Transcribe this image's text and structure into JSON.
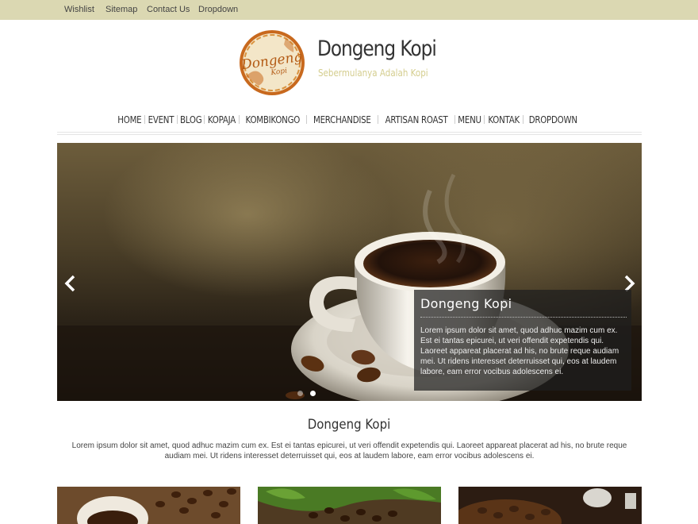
{
  "topbar": {
    "links": [
      "Wishlist",
      "Sitemap",
      "Contact Us",
      "Dropdown"
    ]
  },
  "header": {
    "logo_text_line1": "Dongeng",
    "logo_text_line2": "Kopi",
    "site_title": "Dongeng Kopi",
    "tagline": "Sebermulanya Adalah Kopi"
  },
  "nav": {
    "items": [
      "HOME",
      "EVENT",
      "BLOG",
      "KOPAJA",
      "KOMBIKONGO",
      "MERCHANDISE",
      "ARTISAN ROAST",
      "MENU",
      "KONTAK",
      "DROPDOWN"
    ]
  },
  "slider": {
    "caption_title": "Dongeng Kopi",
    "caption_text": "Lorem ipsum dolor sit amet, quod adhuc mazim cum ex. Est ei tantas epicurei, ut veri offendit expetendis qui. Laoreet appareat placerat ad his, no brute reque audiam mei. Ut ridens interesset deterruisset qui, eos at laudem labore, eam error vocibus adolescens ei.",
    "slide_count": 2,
    "active_slide": 2,
    "prev_icon": "chevron-left-icon",
    "next_icon": "chevron-right-icon"
  },
  "intro": {
    "title": "Dongeng Kopi",
    "text": "Lorem ipsum dolor sit amet, quod adhuc mazim cum ex. Est ei tantas epicurei, ut veri offendit expetendis qui. Laoreet appareat placerat ad his, no brute reque audiam mei. Ut ridens interesset deterruisset qui, eos at laudem labore, eam error vocibus adolescens ei."
  },
  "colors": {
    "topbar_bg": "#dbd8b2",
    "logo_orange": "#c8691e",
    "tagline": "#d4cd8e"
  }
}
